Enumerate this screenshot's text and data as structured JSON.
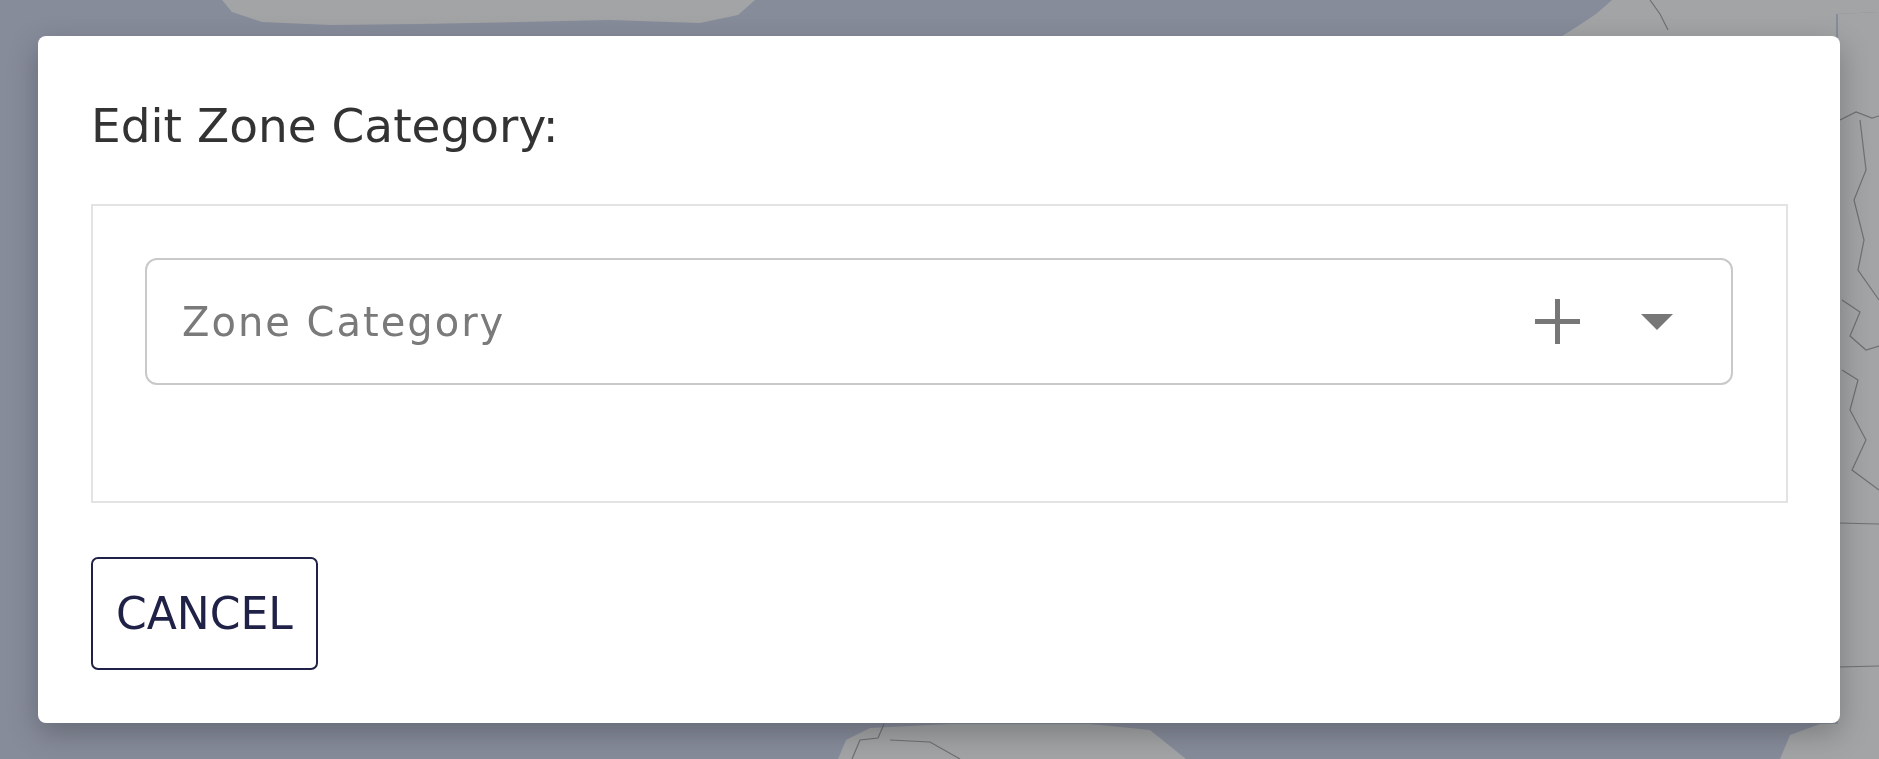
{
  "dialog": {
    "title": "Edit Zone Category:",
    "zone_category": {
      "placeholder": "Zone Category"
    },
    "cancel_button": {
      "label": "CANCEL"
    }
  }
}
